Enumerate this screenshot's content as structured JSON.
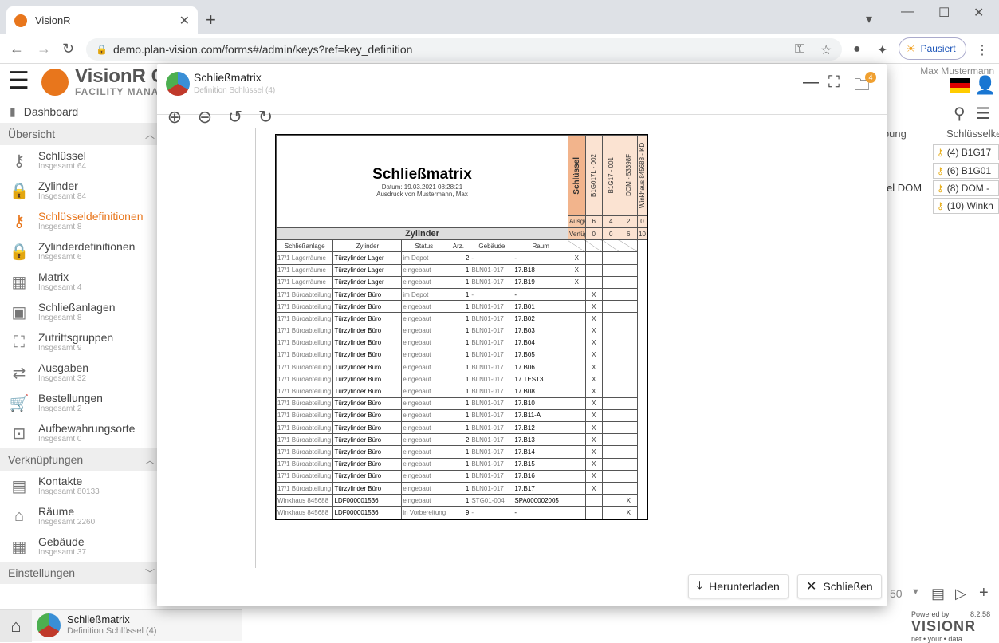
{
  "browser": {
    "tab_title": "VisionR",
    "url": "demo.plan-vision.com/forms#/admin/keys?ref=key_definition",
    "paused_label": "Pausiert"
  },
  "app": {
    "brand_title": "VisionR C",
    "brand_sub": "FACILITY MANAG",
    "user_name": "Max Mustermann"
  },
  "sidebar": {
    "dashboard": "Dashboard",
    "sections": {
      "overview": "Übersicht",
      "links": "Verknüpfungen",
      "settings": "Einstellungen"
    },
    "items": [
      {
        "label": "Schlüssel",
        "sub": "Insgesamt 64"
      },
      {
        "label": "Zylinder",
        "sub": "Insgesamt 84"
      },
      {
        "label": "Schlüsseldefinitionen",
        "sub": "Insgesamt 8"
      },
      {
        "label": "Zylinderdefinitionen",
        "sub": "Insgesamt 6"
      },
      {
        "label": "Matrix",
        "sub": "Insgesamt 4"
      },
      {
        "label": "Schließanlagen",
        "sub": "Insgesamt 8"
      },
      {
        "label": "Zutrittsgruppen",
        "sub": "Insgesamt 9"
      },
      {
        "label": "Ausgaben",
        "sub": "Insgesamt 32"
      },
      {
        "label": "Bestellungen",
        "sub": "Insgesamt 2"
      },
      {
        "label": "Aufbewahrungsorte",
        "sub": "Insgesamt 0"
      }
    ],
    "link_items": [
      {
        "label": "Kontakte",
        "sub": "Insgesamt 80133"
      },
      {
        "label": "Räume",
        "sub": "Insgesamt 2260"
      },
      {
        "label": "Gebäude",
        "sub": "Insgesamt 37"
      }
    ]
  },
  "background": {
    "col1": "ibung",
    "col2": "Schlüsselke",
    "row_left": "el DOM",
    "key_rows": [
      "(4) B1G17",
      "(6) B1G01",
      "(8) DOM -",
      "(10) Winkh"
    ],
    "page_size": "50"
  },
  "taskbar": {
    "title": "Schließmatrix",
    "sub": "Definition Schlüssel (4)"
  },
  "modal": {
    "title": "Schließmatrix",
    "subtitle": "Definition Schlüssel (4)",
    "badge": "4",
    "download_label": "Herunterladen",
    "close_label": "Schließen"
  },
  "document": {
    "title": "Schließmatrix",
    "date": "Datum: 19.03.2021 08:28:21",
    "printed_by": "Ausdruck von Mustermann, Max",
    "keys_label": "Schlüssel",
    "key_columns": [
      "B1G017L - 002",
      "B1G17 - 001",
      "DOM - 53398F",
      "Winkhaus 845688 - KD"
    ],
    "ausgaben_label": "Ausgaben",
    "ausgaben": [
      "6",
      "4",
      "2",
      "0"
    ],
    "verfuegbar_label": "Verfügbar",
    "verfuegbar": [
      "0",
      "0",
      "6",
      "10"
    ],
    "zylinder_label": "Zylinder",
    "headers": [
      "Schließanlage",
      "Zylinder",
      "Status",
      "Arz.",
      "Gebäude",
      "Raum"
    ],
    "rows": [
      {
        "anlage": "17/1 Lagerräume",
        "zyl": "Türzylinder Lager",
        "status": "im Depot",
        "arz": "2",
        "geb": "-",
        "raum": "-",
        "m": [
          "X",
          "",
          "",
          ""
        ]
      },
      {
        "anlage": "17/1 Lagerräume",
        "zyl": "Türzylinder Lager",
        "status": "eingebaut",
        "arz": "1",
        "geb": "BLN01-017",
        "raum": "17.B18",
        "m": [
          "X",
          "",
          "",
          ""
        ]
      },
      {
        "anlage": "17/1 Lagerräume",
        "zyl": "Türzylinder Lager",
        "status": "eingebaut",
        "arz": "1",
        "geb": "BLN01-017",
        "raum": "17.B19",
        "m": [
          "X",
          "",
          "",
          ""
        ]
      },
      {
        "anlage": "17/1 Büroabteilung",
        "zyl": "Türzylinder Büro",
        "status": "im Depot",
        "arz": "1",
        "geb": "-",
        "raum": "-",
        "m": [
          "",
          "X",
          "",
          ""
        ]
      },
      {
        "anlage": "17/1 Büroabteilung",
        "zyl": "Türzylinder Büro",
        "status": "eingebaut",
        "arz": "1",
        "geb": "BLN01-017",
        "raum": "17.B01",
        "m": [
          "",
          "X",
          "",
          ""
        ]
      },
      {
        "anlage": "17/1 Büroabteilung",
        "zyl": "Türzylinder Büro",
        "status": "eingebaut",
        "arz": "1",
        "geb": "BLN01-017",
        "raum": "17.B02",
        "m": [
          "",
          "X",
          "",
          ""
        ]
      },
      {
        "anlage": "17/1 Büroabteilung",
        "zyl": "Türzylinder Büro",
        "status": "eingebaut",
        "arz": "1",
        "geb": "BLN01-017",
        "raum": "17.B03",
        "m": [
          "",
          "X",
          "",
          ""
        ]
      },
      {
        "anlage": "17/1 Büroabteilung",
        "zyl": "Türzylinder Büro",
        "status": "eingebaut",
        "arz": "1",
        "geb": "BLN01-017",
        "raum": "17.B04",
        "m": [
          "",
          "X",
          "",
          ""
        ]
      },
      {
        "anlage": "17/1 Büroabteilung",
        "zyl": "Türzylinder Büro",
        "status": "eingebaut",
        "arz": "1",
        "geb": "BLN01-017",
        "raum": "17.B05",
        "m": [
          "",
          "X",
          "",
          ""
        ]
      },
      {
        "anlage": "17/1 Büroabteilung",
        "zyl": "Türzylinder Büro",
        "status": "eingebaut",
        "arz": "1",
        "geb": "BLN01-017",
        "raum": "17.B06",
        "m": [
          "",
          "X",
          "",
          ""
        ]
      },
      {
        "anlage": "17/1 Büroabteilung",
        "zyl": "Türzylinder Büro",
        "status": "eingebaut",
        "arz": "1",
        "geb": "BLN01-017",
        "raum": "17.TEST3",
        "m": [
          "",
          "X",
          "",
          ""
        ]
      },
      {
        "anlage": "17/1 Büroabteilung",
        "zyl": "Türzylinder Büro",
        "status": "eingebaut",
        "arz": "1",
        "geb": "BLN01-017",
        "raum": "17.B08",
        "m": [
          "",
          "X",
          "",
          ""
        ]
      },
      {
        "anlage": "17/1 Büroabteilung",
        "zyl": "Türzylinder Büro",
        "status": "eingebaut",
        "arz": "1",
        "geb": "BLN01-017",
        "raum": "17.B10",
        "m": [
          "",
          "X",
          "",
          ""
        ]
      },
      {
        "anlage": "17/1 Büroabteilung",
        "zyl": "Türzylinder Büro",
        "status": "eingebaut",
        "arz": "1",
        "geb": "BLN01-017",
        "raum": "17.B11-A",
        "m": [
          "",
          "X",
          "",
          ""
        ]
      },
      {
        "anlage": "17/1 Büroabteilung",
        "zyl": "Türzylinder Büro",
        "status": "eingebaut",
        "arz": "1",
        "geb": "BLN01-017",
        "raum": "17.B12",
        "m": [
          "",
          "X",
          "",
          ""
        ]
      },
      {
        "anlage": "17/1 Büroabteilung",
        "zyl": "Türzylinder Büro",
        "status": "eingebaut",
        "arz": "2",
        "geb": "BLN01-017",
        "raum": "17.B13",
        "m": [
          "",
          "X",
          "",
          ""
        ]
      },
      {
        "anlage": "17/1 Büroabteilung",
        "zyl": "Türzylinder Büro",
        "status": "eingebaut",
        "arz": "1",
        "geb": "BLN01-017",
        "raum": "17.B14",
        "m": [
          "",
          "X",
          "",
          ""
        ]
      },
      {
        "anlage": "17/1 Büroabteilung",
        "zyl": "Türzylinder Büro",
        "status": "eingebaut",
        "arz": "1",
        "geb": "BLN01-017",
        "raum": "17.B15",
        "m": [
          "",
          "X",
          "",
          ""
        ]
      },
      {
        "anlage": "17/1 Büroabteilung",
        "zyl": "Türzylinder Büro",
        "status": "eingebaut",
        "arz": "1",
        "geb": "BLN01-017",
        "raum": "17.B16",
        "m": [
          "",
          "X",
          "",
          ""
        ]
      },
      {
        "anlage": "17/1 Büroabteilung",
        "zyl": "Türzylinder Büro",
        "status": "eingebaut",
        "arz": "1",
        "geb": "BLN01-017",
        "raum": "17.B17",
        "m": [
          "",
          "X",
          "",
          ""
        ]
      },
      {
        "anlage": "Winkhaus 845688",
        "zyl": "LDF000001536",
        "status": "eingebaut",
        "arz": "1",
        "geb": "STG01-004",
        "raum": "SPA000002005",
        "m": [
          "",
          "",
          "",
          "X"
        ]
      },
      {
        "anlage": "Winkhaus 845688",
        "zyl": "LDF000001536",
        "status": "in Vorbereitung",
        "arz": "9",
        "geb": "-",
        "raum": "-",
        "m": [
          "",
          "",
          "",
          "X"
        ]
      }
    ]
  },
  "footer_logo": {
    "powered": "Powered by",
    "name": "VISIONR",
    "tagline": "net • your • data",
    "version": "8.2.58"
  },
  "colors": {
    "accent": "#e8761c",
    "key_header_bg": "#f2b48c"
  }
}
